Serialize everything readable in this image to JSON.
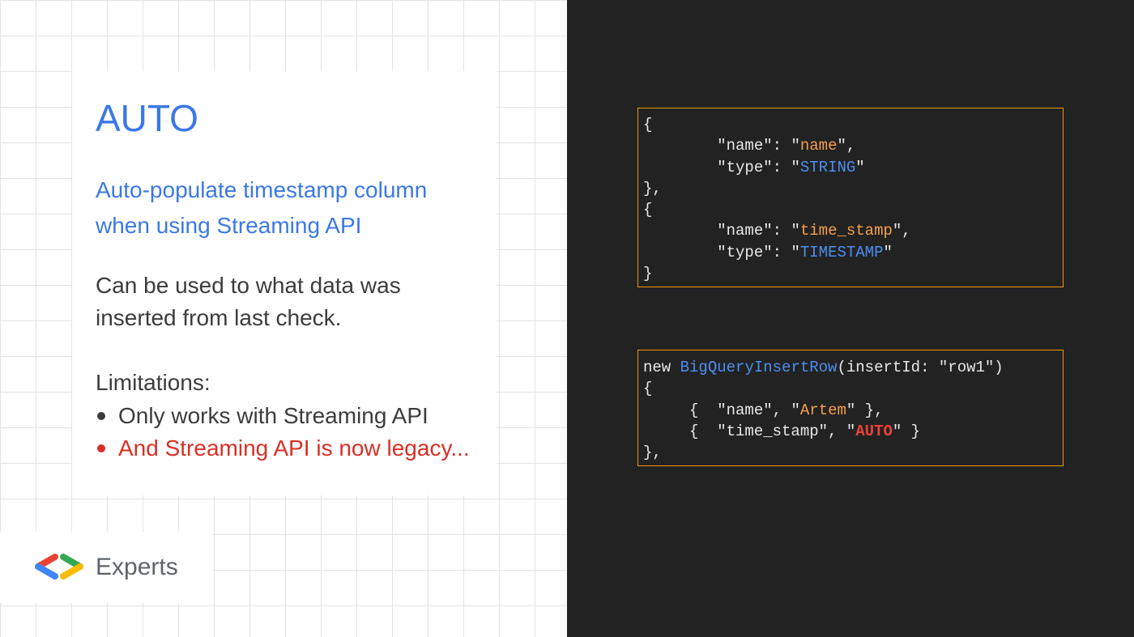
{
  "slide": {
    "title": "AUTO",
    "subtitle": "Auto-populate timestamp column when using Streaming API",
    "body": "Can be used to what data was inserted from last check.",
    "limitations_title": "Limitations:",
    "limitations": [
      "Only works with Streaming API",
      "And Streaming API is now legacy..."
    ]
  },
  "logo": {
    "text": "Experts"
  },
  "code_schema": {
    "open_brace_1": "{",
    "f1_name_key": "\"name\"",
    "f1_name_val": "name",
    "f1_type_key": "\"type\"",
    "f1_type_val": "STRING",
    "close_brace_1": "},",
    "open_brace_2": "{",
    "f2_name_key": "\"name\"",
    "f2_name_val": "time_stamp",
    "f2_type_key": "\"type\"",
    "f2_type_val": "TIMESTAMP",
    "close_brace_2": "}"
  },
  "code_insert": {
    "kw_new": "new",
    "class_name": "BigQueryInsertRow",
    "args": "(insertId: \"row1\")",
    "open_brace": "{",
    "r1_key": "\"name\"",
    "r1_val": "Artem",
    "r2_key": "\"time_stamp\"",
    "r2_val": "AUTO",
    "close_brace": "},"
  },
  "colors": {
    "accent_blue": "#3b78e7",
    "warning_red": "#d93025",
    "code_border": "#f29900",
    "code_string": "#f5a04c",
    "code_type": "#4d8ef0",
    "background_dark": "#222222"
  }
}
